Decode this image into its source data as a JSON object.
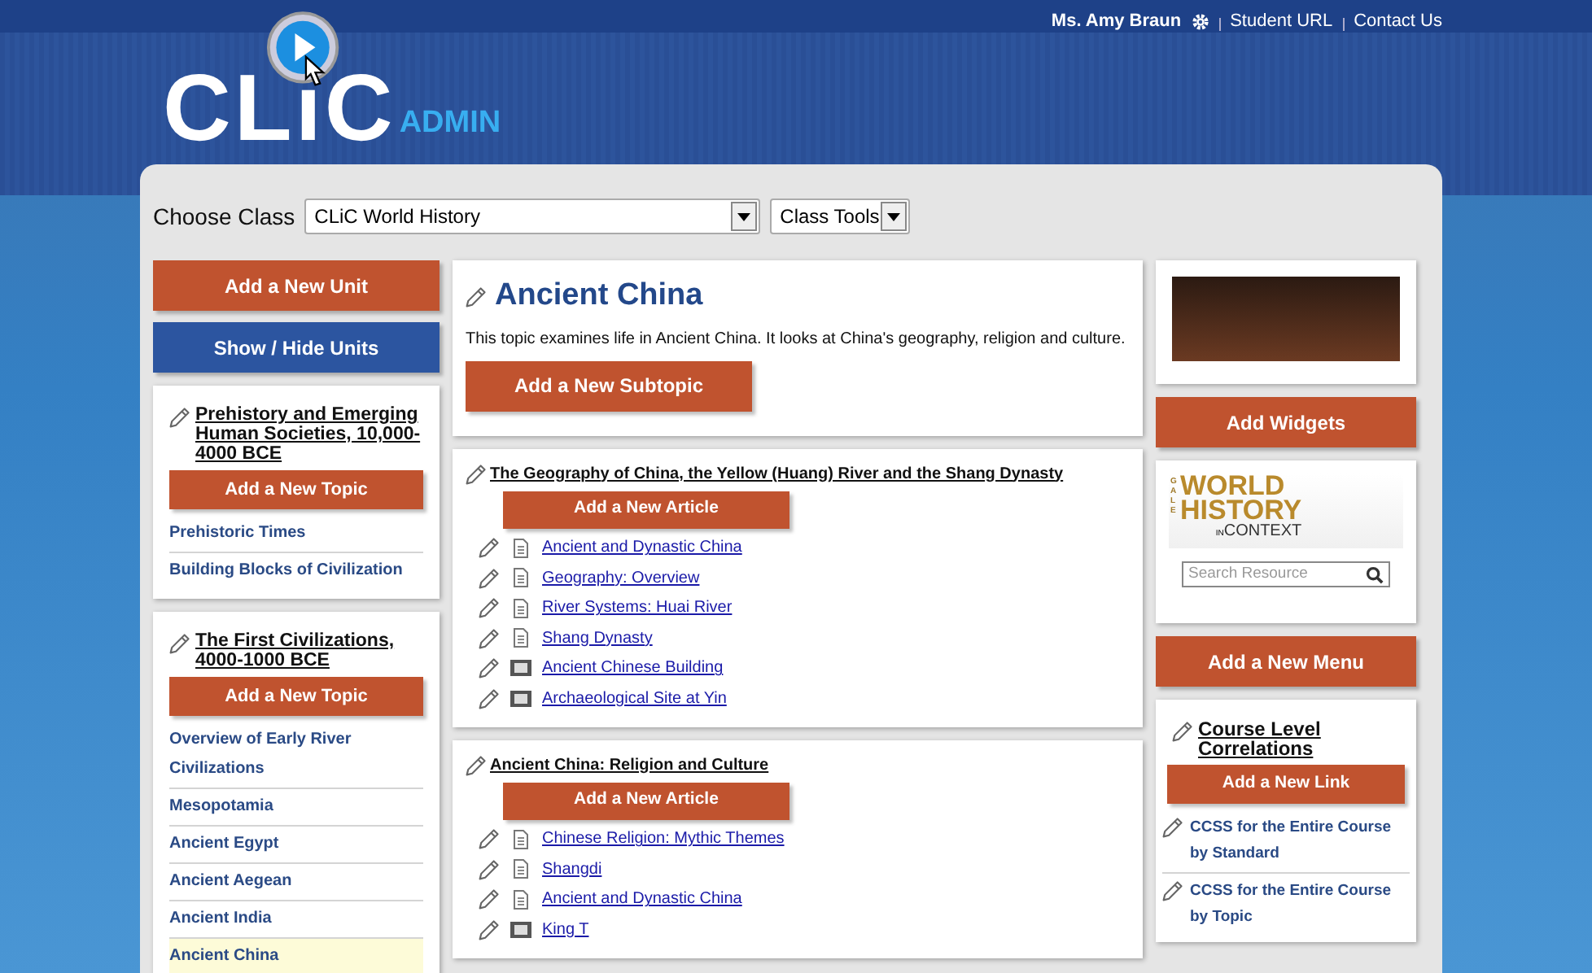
{
  "header": {
    "logo": "CLiC",
    "logo_badge": "ADMIN",
    "user_name": "Ms. Amy Braun",
    "links": [
      "Student URL",
      "Contact Us"
    ]
  },
  "class_bar": {
    "label": "Choose Class",
    "class_select": "CLiC World History",
    "tools_select": "Class Tools"
  },
  "left": {
    "add_unit_button": "Add a New Unit",
    "show_hide_button": "Show / Hide Units",
    "units": [
      {
        "title": "Prehistory and Emerging Human Societies, 10,000-4000 BCE",
        "add_topic_button": "Add a New Topic",
        "topics": [
          {
            "label": "Prehistoric Times",
            "selected": false
          },
          {
            "label": "Building Blocks of Civilization",
            "selected": false
          }
        ]
      },
      {
        "title": "The First Civilizations, 4000-1000 BCE",
        "add_topic_button": "Add a New Topic",
        "topics": [
          {
            "label": "Overview of Early River Civilizations",
            "selected": false
          },
          {
            "label": "Mesopotamia",
            "selected": false
          },
          {
            "label": "Ancient Egypt",
            "selected": false
          },
          {
            "label": "Ancient Aegean",
            "selected": false
          },
          {
            "label": "Ancient India",
            "selected": false
          },
          {
            "label": "Ancient China",
            "selected": true
          }
        ]
      }
    ]
  },
  "center": {
    "topic": {
      "title": "Ancient China",
      "description": "This topic examines life in Ancient China. It looks at China's geography, religion and culture.",
      "add_subtopic_button": "Add a New Subtopic"
    },
    "subtopics": [
      {
        "title": "The Geography of China, the Yellow (Huang) River and the Shang Dynasty",
        "add_article_button": "Add a New Article",
        "articles": [
          {
            "label": "Ancient and Dynastic China",
            "kind": "document"
          },
          {
            "label": "Geography: Overview",
            "kind": "document"
          },
          {
            "label": "River Systems: Huai River",
            "kind": "document"
          },
          {
            "label": "Shang Dynasty",
            "kind": "document"
          },
          {
            "label": "Ancient Chinese Building",
            "kind": "video"
          },
          {
            "label": "Archaeological Site at Yin",
            "kind": "video"
          }
        ]
      },
      {
        "title": "Ancient China: Religion and Culture",
        "add_article_button": "Add a New Article",
        "articles": [
          {
            "label": "Chinese Religion: Mythic Themes",
            "kind": "document"
          },
          {
            "label": "Shangdi",
            "kind": "document"
          },
          {
            "label": "Ancient and Dynastic China",
            "kind": "document"
          },
          {
            "label": "King T",
            "kind": "video"
          }
        ]
      }
    ]
  },
  "right": {
    "add_widgets_button": "Add Widgets",
    "widget": {
      "brand": "GALE",
      "logo_lines": [
        "WORLD",
        "HISTORY"
      ],
      "logo_small": "IN",
      "logo_tail": "CONTEXT",
      "search_placeholder": "Search Resource"
    },
    "add_menu_button": "Add a New Menu",
    "menu": {
      "title": "Course Level Correlations",
      "add_link_button": "Add a New Link",
      "links": [
        "CCSS for the Entire Course by Standard",
        "CCSS for the Entire Course by Topic"
      ]
    }
  }
}
